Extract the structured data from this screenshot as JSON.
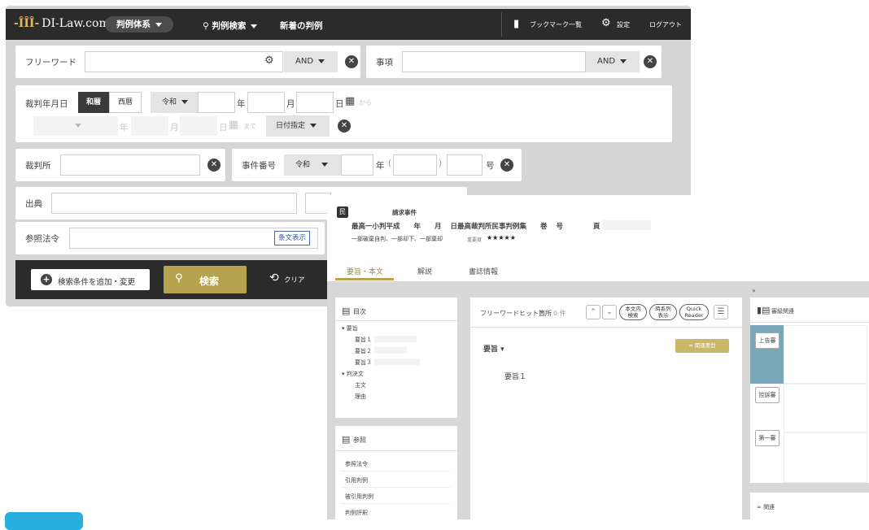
{
  "colors": {
    "nav_bg": "#2b2b2b",
    "accent_gold": "#b5a24d",
    "sidebar_blue": "#7aa7b8",
    "fab_blue": "#29aee0"
  },
  "nav": {
    "logo": "DI-Law.com",
    "menu_case_system": "判例体系",
    "menu_case_search": "判例検索",
    "menu_new_cases": "新着の判例",
    "bookmark_list": "ブックマーク一覧",
    "settings": "設定",
    "logout": "ログアウト"
  },
  "search": {
    "free_word": {
      "label": "フリーワード",
      "value": "",
      "operator": "AND"
    },
    "matter": {
      "label": "事項",
      "value": "",
      "operator": "AND"
    },
    "date": {
      "label": "裁判年月日",
      "tab_wareki": "和暦",
      "tab_seireki": "西暦",
      "era": "令和",
      "year_unit": "年",
      "month_unit": "月",
      "day_unit": "日",
      "from": "から",
      "to": "まで",
      "mode": "日付指定"
    },
    "court": {
      "label": "裁判所",
      "value": ""
    },
    "case_number": {
      "label": "事件番号",
      "era": "令和",
      "year_unit": "年",
      "paren_open": "(",
      "paren_close": ")",
      "number_unit": "号"
    },
    "source": {
      "label": "出典"
    },
    "reference_law": {
      "label": "参照法令",
      "fulltext_button": "条文表示"
    },
    "add_condition": "検索条件を追加・変更",
    "search_button": "検索",
    "clear_button": "クリア"
  },
  "case": {
    "badge": "民",
    "title": "請求事件",
    "citation": {
      "court": "最高一小判平成",
      "year_unit": "年",
      "month_unit": "月",
      "day_unit": "日",
      "reporter": "最高裁判所民事判例集",
      "volume_unit": "巻",
      "number_unit": "号",
      "page_unit": "頁"
    },
    "result": "一部破棄自判、一部却下、一部棄却",
    "importance_label": "重要度",
    "importance_stars": "★★★★★",
    "tabs": [
      "要旨・本文",
      "解説",
      "書誌情報"
    ],
    "toc": {
      "title": "目次",
      "items": [
        "要旨",
        "要旨１",
        "要旨２",
        "要旨３",
        "判決文",
        "主文",
        "理由"
      ]
    },
    "refs": {
      "title": "参照",
      "items": [
        "参照法令",
        "引用判例",
        "被引用判例",
        "判例評釈"
      ]
    },
    "hits": {
      "label": "フリーワードヒット箇所",
      "count": "0 件",
      "btn_in_text": [
        "本文内",
        "検索"
      ],
      "btn_timeline": [
        "時系列",
        "表示"
      ],
      "btn_quick": [
        "Quick",
        "Reader"
      ]
    },
    "summary": {
      "heading": "要旨",
      "related_button": "関連要旨",
      "item": "要旨１"
    },
    "side": {
      "collapse": "»",
      "trial_title": "審級関連",
      "buttons": [
        "上告審",
        "控訴審",
        "第一審"
      ],
      "related": "関連"
    }
  }
}
